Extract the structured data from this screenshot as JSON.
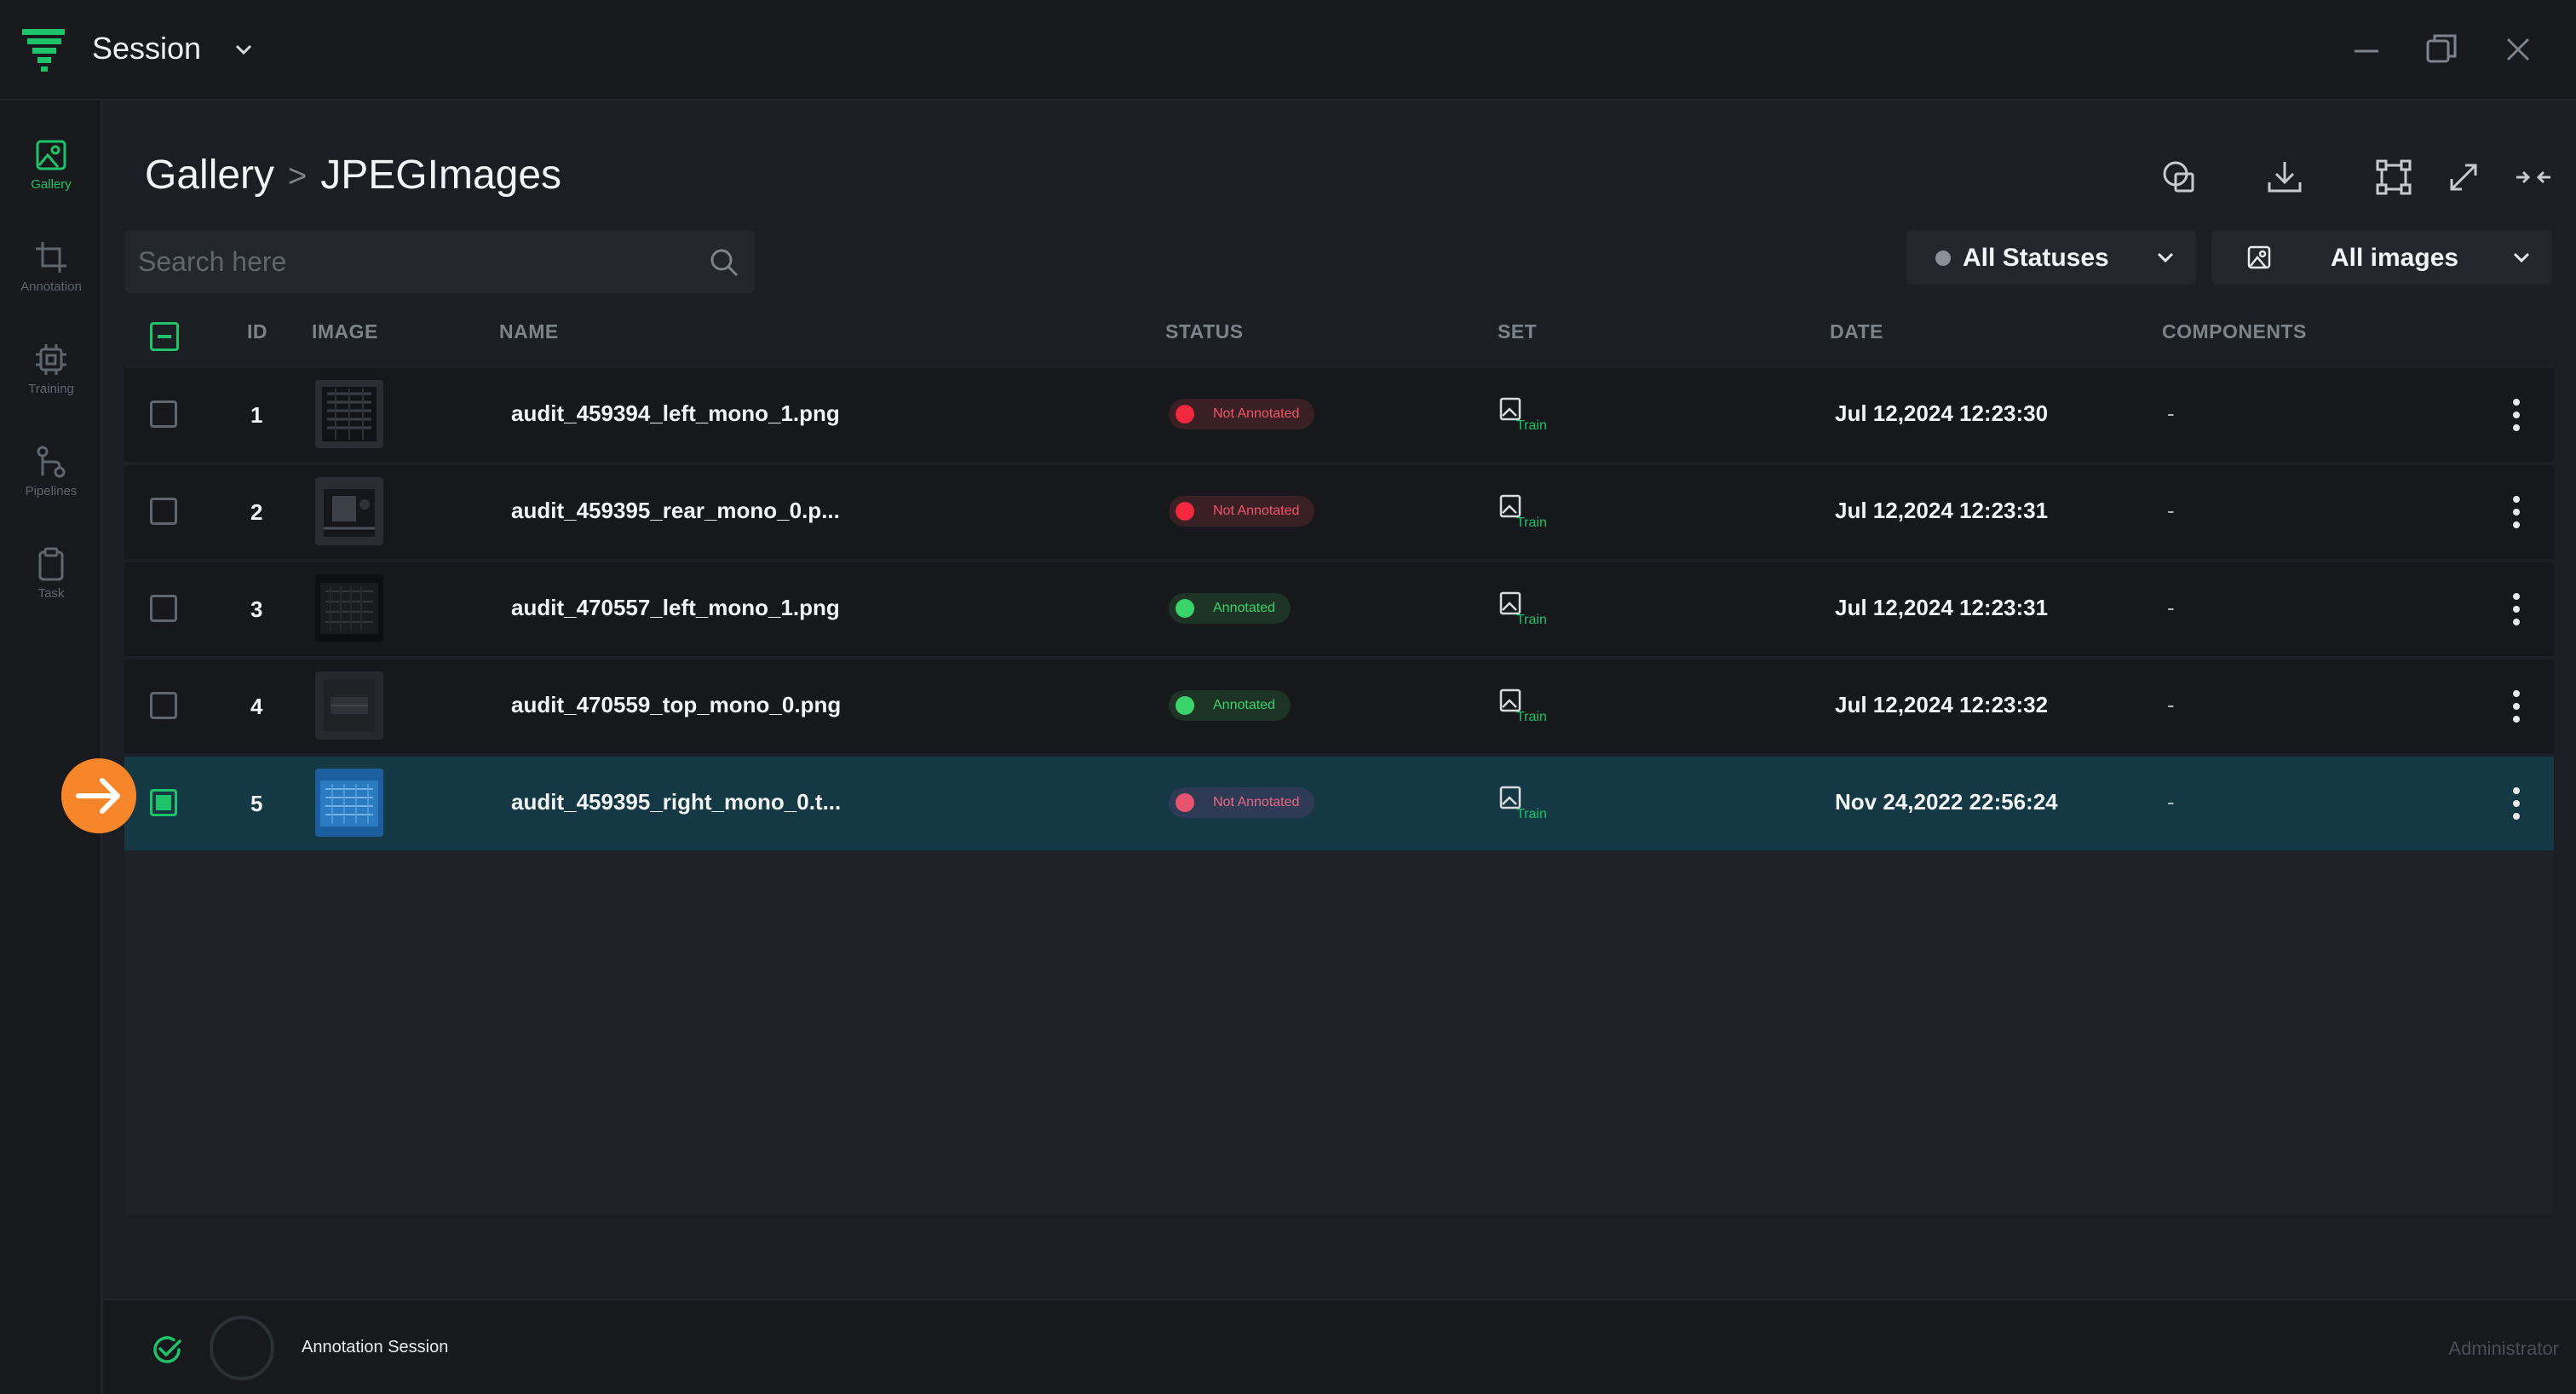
{
  "titlebar": {
    "title": "Session"
  },
  "sidebar": {
    "items": [
      {
        "label": "Gallery",
        "icon": "gallery-icon",
        "active": true
      },
      {
        "label": "Annotation",
        "icon": "crop-icon",
        "active": false
      },
      {
        "label": "Training",
        "icon": "chip-icon",
        "active": false
      },
      {
        "label": "Pipelines",
        "icon": "pipeline-icon",
        "active": false
      },
      {
        "label": "Task",
        "icon": "clipboard-icon",
        "active": false
      }
    ]
  },
  "header": {
    "breadcrumb_root": "Gallery",
    "breadcrumb_sep": ">",
    "breadcrumb_current": "JPEGImages"
  },
  "search": {
    "placeholder": "Search here"
  },
  "filters": {
    "status": "All Statuses",
    "images": "All images"
  },
  "table": {
    "columns": [
      "ID",
      "IMAGE",
      "NAME",
      "STATUS",
      "SET",
      "DATE",
      "COMPONENTS"
    ],
    "rows": [
      {
        "id": "1",
        "name": "audit_459394_left_mono_1.png",
        "status": "Not Annotated",
        "set": "Train",
        "date": "Jul 12,2024 12:23:30",
        "components": "-"
      },
      {
        "id": "2",
        "name": "audit_459395_rear_mono_0.p...",
        "status": "Not Annotated",
        "set": "Train",
        "date": "Jul 12,2024 12:23:31",
        "components": "-"
      },
      {
        "id": "3",
        "name": "audit_470557_left_mono_1.png",
        "status": "Annotated",
        "set": "Train",
        "date": "Jul 12,2024 12:23:31",
        "components": "-"
      },
      {
        "id": "4",
        "name": "audit_470559_top_mono_0.png",
        "status": "Annotated",
        "set": "Train",
        "date": "Jul 12,2024 12:23:32",
        "components": "-"
      },
      {
        "id": "5",
        "name": "audit_459395_right_mono_0.t...",
        "status": "Not Annotated",
        "set": "Train",
        "date": "Nov 24,2022 22:56:24",
        "components": "-"
      }
    ]
  },
  "footer": {
    "session_name": "Annotation Session",
    "user_role": "Administrator"
  },
  "colors": {
    "accent": "#1fc36a",
    "not_annotated": "#f2283e",
    "annotated": "#3bd46b",
    "selected_row": "#143944",
    "arrow": "#f7862a"
  }
}
